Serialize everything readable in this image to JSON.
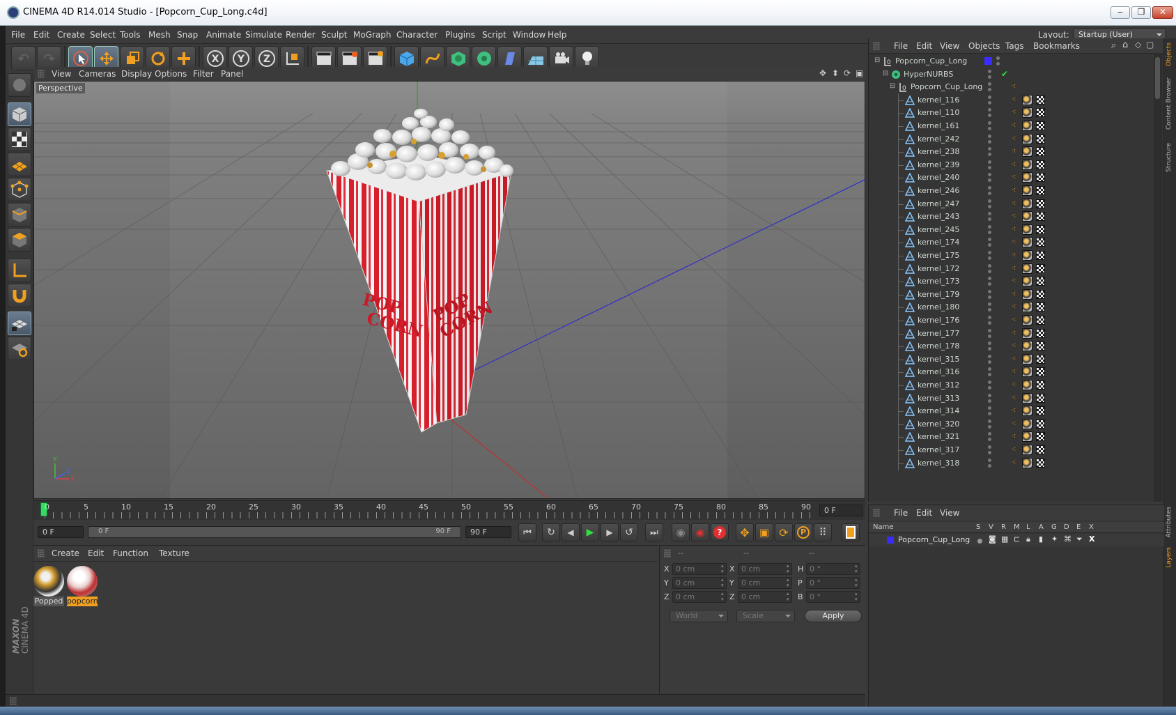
{
  "window": {
    "title": "CINEMA 4D R14.014 Studio - [Popcorn_Cup_Long.c4d]"
  },
  "menubar": {
    "items": [
      "File",
      "Edit",
      "Create",
      "Select",
      "Tools",
      "Mesh",
      "Snap",
      "Animate",
      "Simulate",
      "Render",
      "Sculpt",
      "MoGraph",
      "Character",
      "Plugins",
      "Script",
      "Window",
      "Help"
    ],
    "layout_label": "Layout:",
    "layout_value": "Startup (User)"
  },
  "viewport": {
    "menu": [
      "View",
      "Cameras",
      "Display",
      "Options",
      "Filter",
      "Panel"
    ],
    "label": "Perspective",
    "cup_text_1": "POP",
    "cup_text_2": "CORN"
  },
  "timeline": {
    "ticks": [
      "0",
      "5",
      "10",
      "15",
      "20",
      "25",
      "30",
      "35",
      "40",
      "45",
      "50",
      "55",
      "60",
      "65",
      "70",
      "75",
      "80",
      "85",
      "90"
    ],
    "current_frame_field": "0 F",
    "start_field": "0 F",
    "range_start": "0 F",
    "range_end": "90 F",
    "end_field": "90 F"
  },
  "material_manager": {
    "menu": [
      "Create",
      "Edit",
      "Function",
      "Texture"
    ],
    "materials": [
      {
        "label": "Popped",
        "selected": false
      },
      {
        "label": "popcorn",
        "selected": true
      }
    ]
  },
  "coordinates": {
    "header": [
      "--",
      "--",
      "--"
    ],
    "rows": [
      {
        "a": "X",
        "av": "0 cm",
        "b": "X",
        "bv": "0 cm",
        "c": "H",
        "cv": "0 °"
      },
      {
        "a": "Y",
        "av": "0 cm",
        "b": "Y",
        "bv": "0 cm",
        "c": "P",
        "cv": "0 °"
      },
      {
        "a": "Z",
        "av": "0 cm",
        "b": "Z",
        "bv": "0 cm",
        "c": "B",
        "cv": "0 °"
      }
    ],
    "mode1": "World",
    "mode2": "Scale",
    "apply_label": "Apply"
  },
  "objects_panel": {
    "menu": [
      "File",
      "Edit",
      "View",
      "Objects",
      "Tags",
      "Bookmarks"
    ],
    "root": "Popcorn_Cup_Long",
    "hypernurbs": "HyperNURBS",
    "group": "Popcorn_Cup_Long",
    "kernels": [
      "kernel_116",
      "kernel_110",
      "kernel_161",
      "kernel_242",
      "kernel_238",
      "kernel_239",
      "kernel_240",
      "kernel_246",
      "kernel_247",
      "kernel_243",
      "kernel_245",
      "kernel_174",
      "kernel_175",
      "kernel_172",
      "kernel_173",
      "kernel_179",
      "kernel_180",
      "kernel_176",
      "kernel_177",
      "kernel_178",
      "kernel_315",
      "kernel_316",
      "kernel_312",
      "kernel_313",
      "kernel_314",
      "kernel_320",
      "kernel_321",
      "kernel_317",
      "kernel_318"
    ]
  },
  "right_tabs": [
    "Objects",
    "Content Browser",
    "Structure",
    "Attributes",
    "Layers"
  ],
  "layers_panel": {
    "menu": [
      "File",
      "Edit",
      "View"
    ],
    "headers": [
      "Name",
      "S",
      "V",
      "R",
      "M",
      "L",
      "A",
      "G",
      "D",
      "E",
      "X"
    ],
    "row_name": "Popcorn_Cup_Long"
  },
  "branding": {
    "line1": "MAXON",
    "line2": "CINEMA 4D"
  },
  "colors": {
    "accent": "#f0a020",
    "layer_color": "#3a2cff",
    "bg": "#3a3a3a"
  }
}
